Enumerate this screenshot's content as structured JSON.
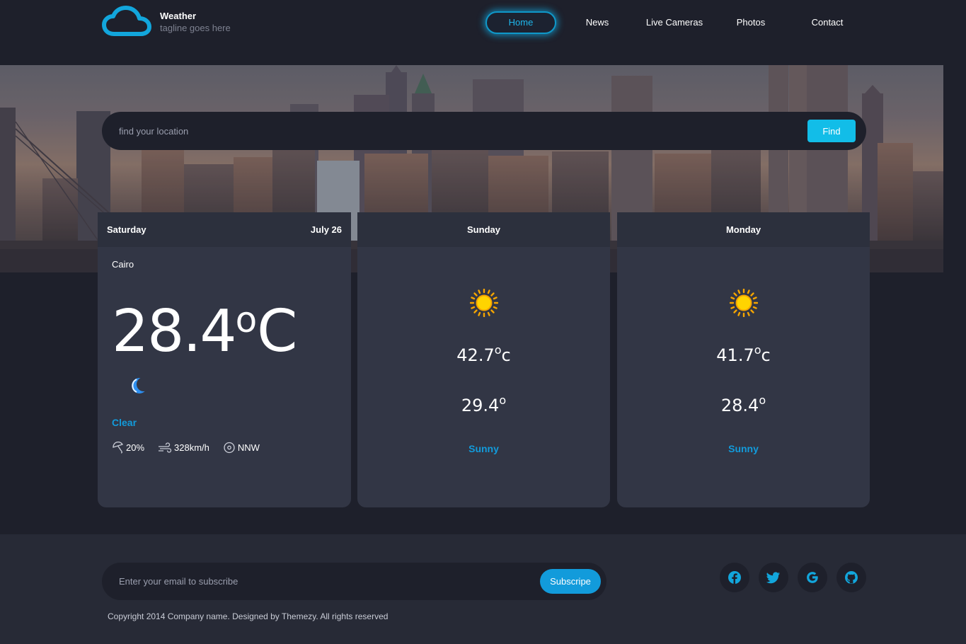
{
  "brand": {
    "title": "Weather",
    "tagline": "tagline goes here"
  },
  "nav": {
    "items": [
      {
        "label": "Home",
        "active": true
      },
      {
        "label": "News"
      },
      {
        "label": "Live Cameras"
      },
      {
        "label": "Photos"
      },
      {
        "label": "Contact"
      }
    ]
  },
  "search": {
    "placeholder": "find your location",
    "button": "Find"
  },
  "today": {
    "day": "Saturday",
    "date": "July 26",
    "city": "Cairo",
    "temp": "28.4",
    "unit_degree": "o",
    "unit": "C",
    "icon": "moon-icon",
    "condition": "Clear",
    "rain": "20%",
    "wind": "328km/h",
    "direction": "NNW"
  },
  "forecast": [
    {
      "day": "Sunday",
      "icon": "sun-icon",
      "high": "42.7",
      "high_deg": "o",
      "high_unit": "c",
      "low": "29.4",
      "low_deg": "o",
      "condition": "Sunny"
    },
    {
      "day": "Monday",
      "icon": "sun-icon",
      "high": "41.7",
      "high_deg": "o",
      "high_unit": "c",
      "low": "28.4",
      "low_deg": "o",
      "condition": "Sunny"
    }
  ],
  "footer": {
    "email_placeholder": "Enter your email to subscribe",
    "subscribe": "Subscripe",
    "social": [
      "facebook-icon",
      "twitter-icon",
      "google-icon",
      "github-icon"
    ],
    "copyright": "Copyright 2014 Company name. Designed by Themezy. All rights reserved"
  },
  "colors": {
    "accent": "#129bdb",
    "find": "#12bde8",
    "background": "#1e202b",
    "card": "#323645"
  }
}
